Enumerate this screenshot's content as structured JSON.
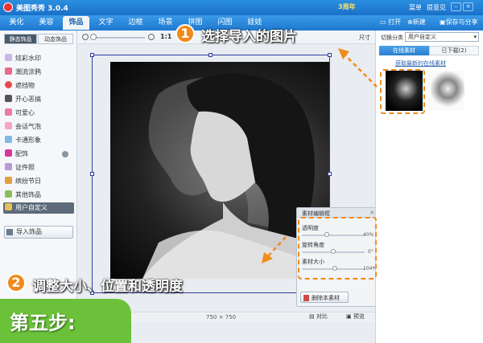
{
  "app": {
    "title": "美图秀秀 3.0.4",
    "anniversary": "3周年",
    "menu": [
      "菜单",
      "提意见"
    ]
  },
  "tabs": [
    "美化",
    "美容",
    "饰品",
    "文字",
    "边框",
    "场景",
    "拼图",
    "闪图",
    "娃娃"
  ],
  "active_tab": "饰品",
  "toolbar_right": [
    "打开",
    "新建",
    "保存与分享"
  ],
  "left": {
    "subtabs": [
      "静态饰品",
      "动态饰品"
    ],
    "categories": [
      "炫彩水印",
      "潮流涂鸦",
      "遮挡物",
      "开心恶搞",
      "可爱心",
      "会话气泡",
      "卡通形象",
      "配饰",
      "证件照",
      "缤纷节日",
      "其他饰品",
      "用户自定义"
    ],
    "selected_category": "用户自定义",
    "import_button": "导入饰品"
  },
  "zoom": {
    "label": "1:1",
    "size_label": "尺寸"
  },
  "status": {
    "dimensions": "750 × 750",
    "compare": "对比",
    "preview": "预览"
  },
  "right": {
    "category_label": "切换分类",
    "category_value": "用户自定义",
    "tabs": [
      "在线素材",
      "已下载(2)"
    ],
    "link": "获取最新的在线素材"
  },
  "material_panel": {
    "title": "素材编辑框",
    "opacity_label": "透明度",
    "opacity_value": "40%",
    "opacity": 0.4,
    "rotate_label": "旋转角度",
    "rotate_value": "0°",
    "rotate": 0.5,
    "size_label": "素材大小",
    "size_value": "104%",
    "size": 0.52,
    "delete_button": "删除本素材"
  },
  "annotations": {
    "step1_num": "1",
    "step1_text": "选择导入的图片",
    "step2_num": "2",
    "step2_text": "调整大小、位置和透明度",
    "step_banner": "第五步:"
  },
  "colors": {
    "accent": "#f08a1a",
    "titlebar": "#1a70c8",
    "banner": "#6bc23a"
  }
}
